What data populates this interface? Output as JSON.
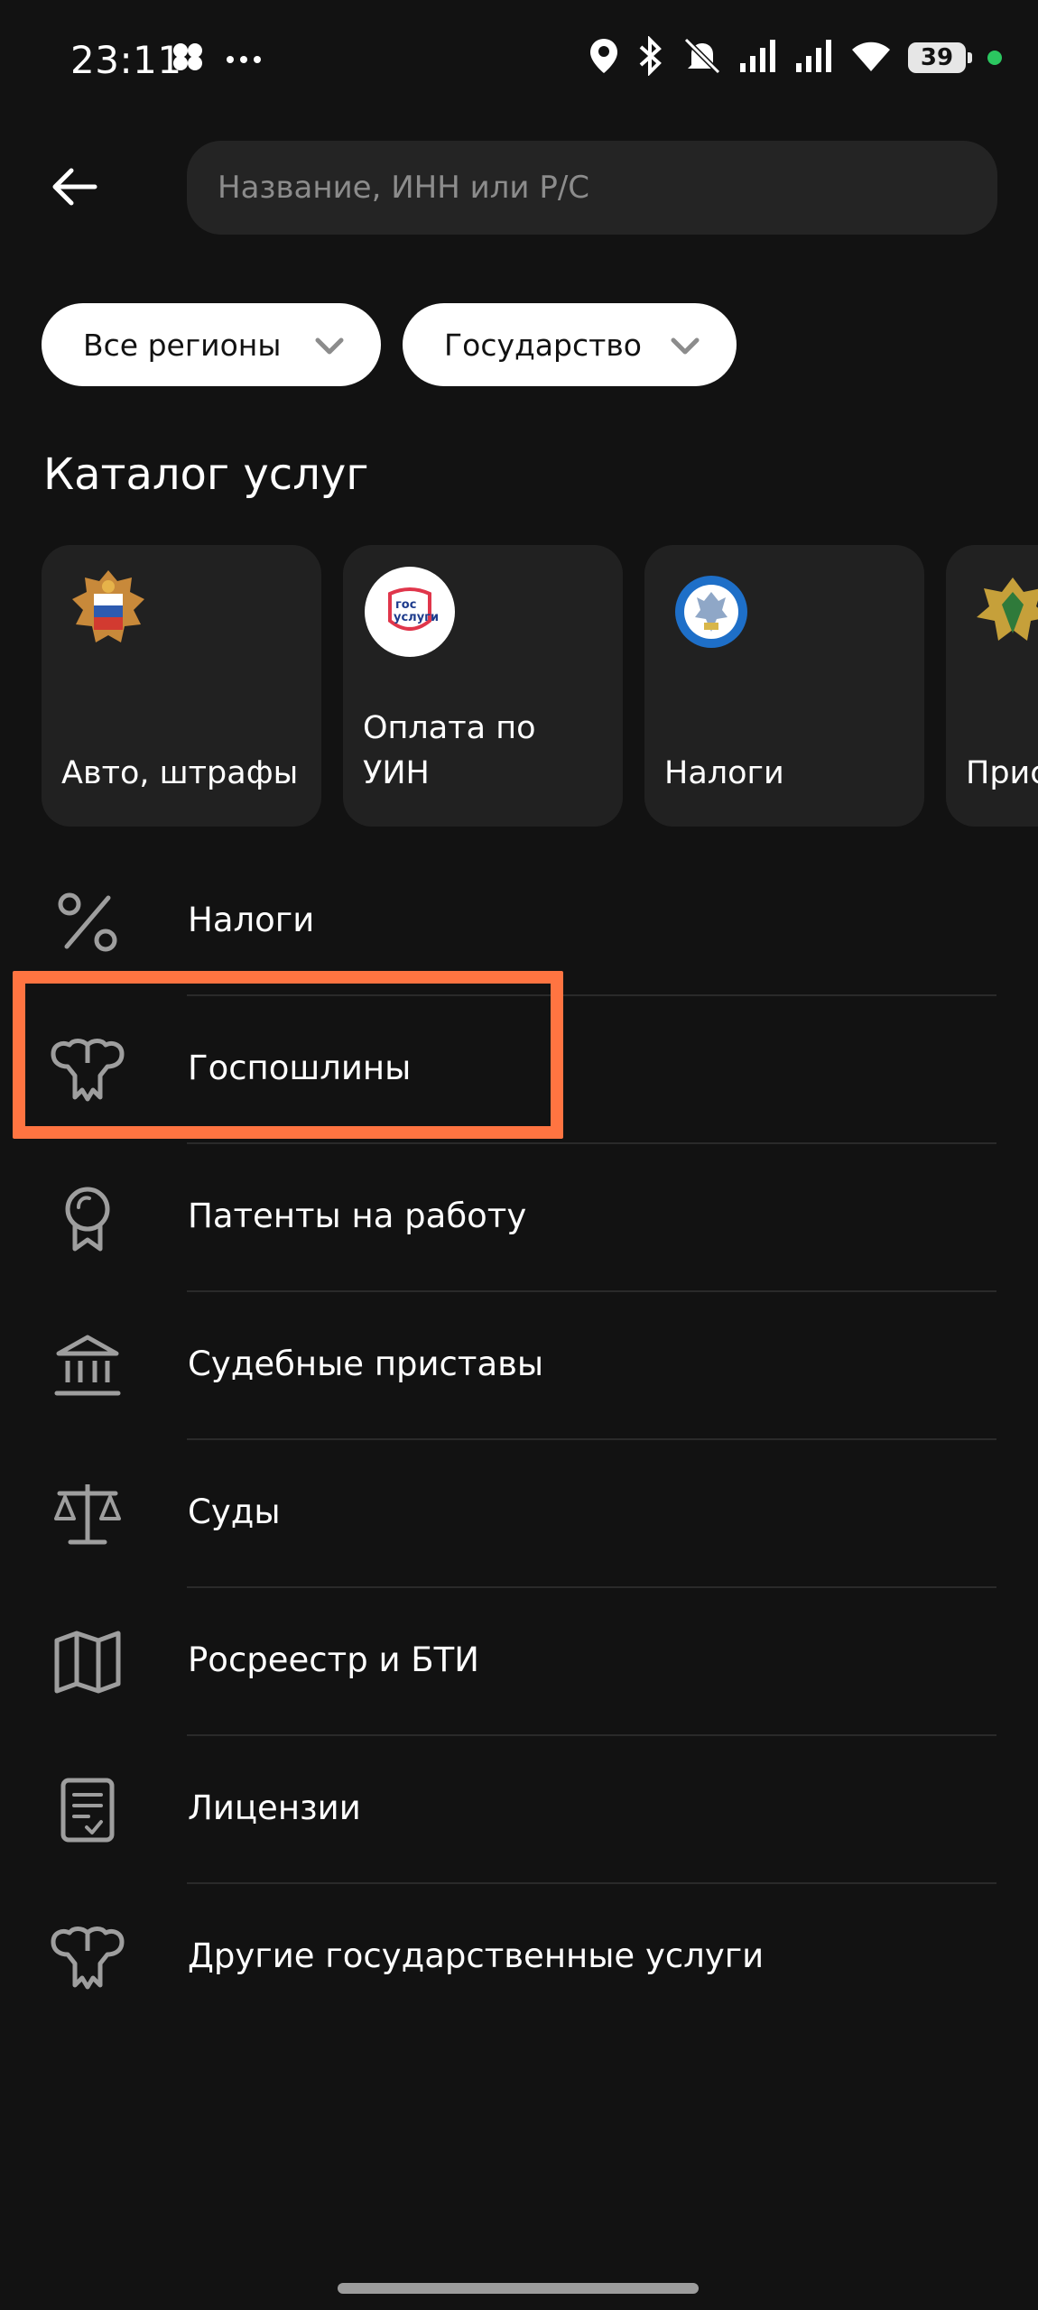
{
  "status_bar": {
    "time": "23:11",
    "battery": "39",
    "icons": [
      "apps-icon",
      "more-dots-icon",
      "location-icon",
      "bluetooth-icon",
      "mute-icon",
      "signal-icon",
      "signal-icon",
      "wifi-icon",
      "battery-icon"
    ]
  },
  "header": {
    "back_icon": "arrow-left-icon",
    "search_placeholder": "Название, ИНН или Р/С"
  },
  "filters": [
    {
      "label": "Все регионы"
    },
    {
      "label": "Государство"
    }
  ],
  "catalog": {
    "title": "Каталог услуг",
    "cards": [
      {
        "label": "Авто, штрафы",
        "icon": "gibdd-emblem-icon"
      },
      {
        "label": "Оплата по УИН",
        "line1": "Оплата по",
        "line2": "УИН",
        "icon": "gosuslugi-logo-icon",
        "logo_text_1": "гос",
        "logo_text_2": "услуги"
      },
      {
        "label": "Налоги",
        "icon": "fns-emblem-icon"
      },
      {
        "label": "Прис",
        "icon": "fssp-emblem-icon"
      }
    ]
  },
  "services": [
    {
      "label": "Налоги",
      "icon": "percent-icon"
    },
    {
      "label": "Госпошлины",
      "icon": "eagle-icon"
    },
    {
      "label": "Патенты на работу",
      "icon": "medal-icon"
    },
    {
      "label": "Судебные приставы",
      "icon": "bank-building-icon"
    },
    {
      "label": "Суды",
      "icon": "scales-icon"
    },
    {
      "label": "Росреестр и БТИ",
      "icon": "map-icon"
    },
    {
      "label": "Лицензии",
      "icon": "document-check-icon"
    },
    {
      "label": "Другие государственные услуги",
      "icon": "eagle-icon"
    }
  ],
  "colors": {
    "background": "#121212",
    "card": "#212121",
    "search": "#242424",
    "highlight": "#ff7441",
    "icon": "#9e9e9e"
  }
}
